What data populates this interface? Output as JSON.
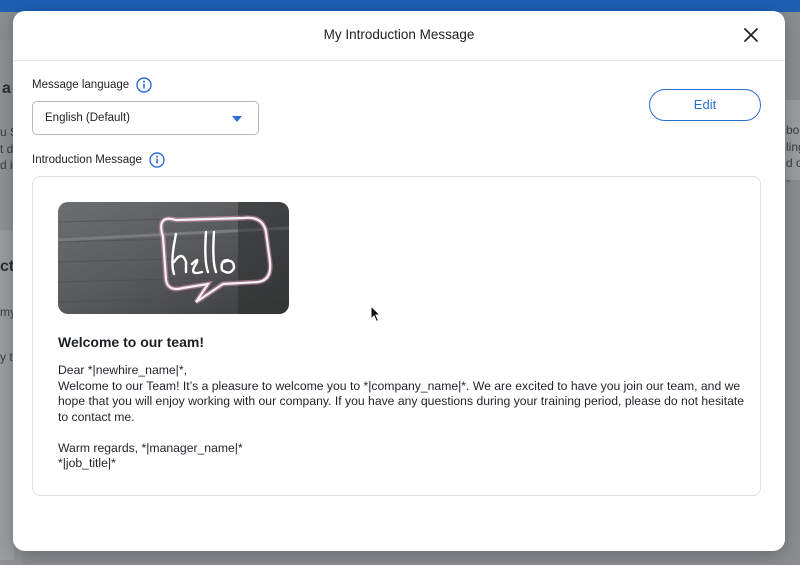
{
  "background": {
    "fragments": [
      {
        "id": "frag-1",
        "text": "a"
      },
      {
        "id": "frag-2",
        "text": "u S"
      },
      {
        "id": "frag-3",
        "text": "t d"
      },
      {
        "id": "frag-4",
        "text": "d i"
      },
      {
        "id": "frag-5",
        "text": "cti"
      },
      {
        "id": "frag-6",
        "text": "my"
      },
      {
        "id": "frag-7",
        "text": "y tu"
      },
      {
        "id": "frag-8",
        "text": "bou"
      },
      {
        "id": "frag-9",
        "text": "ling"
      },
      {
        "id": "frag-10",
        "text": "d o"
      },
      {
        "id": "frag-11",
        "text": "-"
      }
    ]
  },
  "modal": {
    "title": "My Introduction Message",
    "close_icon": "close-icon",
    "language_label": "Message language",
    "language_value": "English (Default)",
    "edit_label": "Edit",
    "intro_label": "Introduction Message",
    "info_icon": "info-icon",
    "message": {
      "image_alt": "hello neon sign",
      "heading": "Welcome to our team!",
      "line_1": "Dear *|newhire_name|*,",
      "line_2": "Welcome to our Team! It’s a pleasure to welcome you to *|company_name|*. We are excited to have you join our team, and we hope that you will enjoy working with our company. If you have any questions during your training period, please do not hesitate to contact me.",
      "line_3": "Warm regards, *|manager_name|*",
      "line_4": "*|job_title|*"
    }
  },
  "colors": {
    "accent": "#2a6fd4",
    "topbar": "#1e5fb4",
    "overlay": "#8a8e91"
  }
}
